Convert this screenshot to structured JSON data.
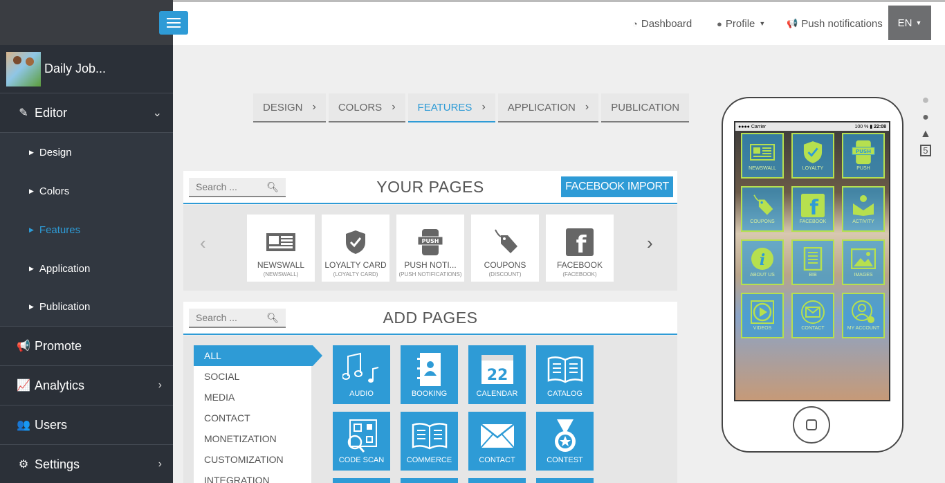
{
  "sidebar": {
    "app_name": "Daily Job...",
    "items": [
      {
        "label": "Editor",
        "icon": "pencil-icon"
      },
      {
        "label": "Promote",
        "icon": "megaphone-icon"
      },
      {
        "label": "Analytics",
        "icon": "chart-icon"
      },
      {
        "label": "Users",
        "icon": "users-icon"
      },
      {
        "label": "Settings",
        "icon": "gears-icon"
      }
    ],
    "editor_sub": [
      {
        "label": "Design"
      },
      {
        "label": "Colors"
      },
      {
        "label": "Features"
      },
      {
        "label": "Application"
      },
      {
        "label": "Publication"
      }
    ]
  },
  "topbar": {
    "dashboard": "Dashboard",
    "profile": "Profile",
    "push": "Push notifications",
    "lang": "EN"
  },
  "steps": [
    "DESIGN",
    "COLORS",
    "FEATURES",
    "APPLICATION",
    "PUBLICATION"
  ],
  "your_pages": {
    "search_placeholder": "Search ...",
    "title": "YOUR PAGES",
    "import_button": "FACEBOOK IMPORT",
    "cards": [
      {
        "name": "NEWSWALL",
        "sub": "(NEWSWALL)"
      },
      {
        "name": "LOYALTY CARD",
        "sub": "(LOYALTY CARD)"
      },
      {
        "name": "PUSH NOTI...",
        "sub": "(PUSH NOTIFICATIONS)"
      },
      {
        "name": "COUPONS",
        "sub": "(DISCOUNT)"
      },
      {
        "name": "FACEBOOK",
        "sub": "(FACEBOOK)"
      }
    ]
  },
  "add_pages": {
    "search_placeholder": "Search ...",
    "title": "ADD PAGES",
    "categories": [
      "ALL",
      "SOCIAL",
      "MEDIA",
      "CONTACT",
      "MONETIZATION",
      "CUSTOMIZATION",
      "INTEGRATION"
    ],
    "tiles": [
      {
        "name": "AUDIO"
      },
      {
        "name": "BOOKING"
      },
      {
        "name": "CALENDAR",
        "num": "22"
      },
      {
        "name": "CATALOG"
      },
      {
        "name": "CODE SCAN"
      },
      {
        "name": "COMMERCE"
      },
      {
        "name": "CONTACT"
      },
      {
        "name": "CONTEST"
      }
    ]
  },
  "phone": {
    "carrier": "Carrier",
    "battery": "100 %",
    "time": "22:08",
    "tiles": [
      "NEWSWALL",
      "LOYALTY",
      "PUSH",
      "COUPONS",
      "FACEBOOK",
      "ACTIVITY",
      "ABOUT US",
      "BIB",
      "IMAGES",
      "VIDEOS",
      "CONTACT",
      "MY ACCOUNT"
    ],
    "push_badge": "PUSH"
  },
  "colors": {
    "accent": "#2e9bd6",
    "sidebar": "#313740",
    "phone_tile_border": "#b6e04f"
  }
}
